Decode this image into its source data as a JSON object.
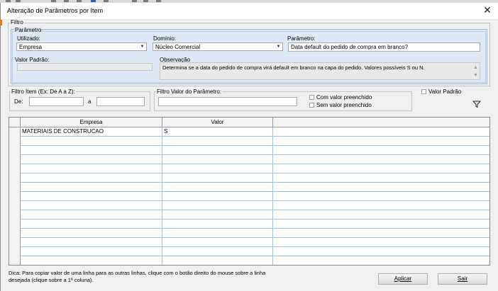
{
  "window": {
    "title": "Alteração de Parâmetros por Item",
    "close_glyph": "✕"
  },
  "filtro": {
    "legend": "Filtro",
    "parametro_group": {
      "legend": "Parâmetro",
      "utilizado_label": "Utilizado:",
      "utilizado_value": "Empresa",
      "dominio_label": "Domínio:",
      "dominio_value": "Núcleo Comercial",
      "parametro_label": "Parâmetro:",
      "parametro_value": "Data default do pedido de compra em branco?",
      "valor_padrao_label": "Valor Padrão:",
      "valor_padrao_value": "",
      "observacao_label": "Observação",
      "observacao_text": "Determina se a data do pedido de compra virá default em branco na capa do pedido. Valores possíveis S ou N."
    }
  },
  "filtro_item": {
    "legend": "Filtro Item (Ex: De A a Z):",
    "de_label": "De:",
    "de_value": "",
    "a_label": "a",
    "a_value": ""
  },
  "filtro_valor": {
    "legend": "Filtro Valor do Parâmetro:",
    "value": "",
    "com_valor_label": "Com valor preenchido",
    "com_valor_checked": false,
    "sem_valor_label": "Sem valor preenchido",
    "sem_valor_checked": false
  },
  "valor_padrao_checkbox": {
    "label": "Valor Padrão",
    "checked": false
  },
  "filter_icon": "filter-funnel-icon",
  "grid": {
    "columns": [
      "Empresa",
      "Valor"
    ],
    "rows": [
      [
        "MATERIAIS DE CONSTRUCAO",
        "S"
      ]
    ],
    "empty_rows": 14
  },
  "hint": {
    "line1": "Dica: Para copiar valor de uma linha para as outras linhas, clique com o botão direito do mouse sobre a linha",
    "line2": "desejada (clique sobre a 1ª coluna)."
  },
  "buttons": {
    "aplicar": "Aplicar",
    "sair": "Sair"
  },
  "colors": {
    "filtro_background": "#dfe9f5",
    "grid_line": "#9ec3ea",
    "accent_orange": "#e07a1a"
  }
}
